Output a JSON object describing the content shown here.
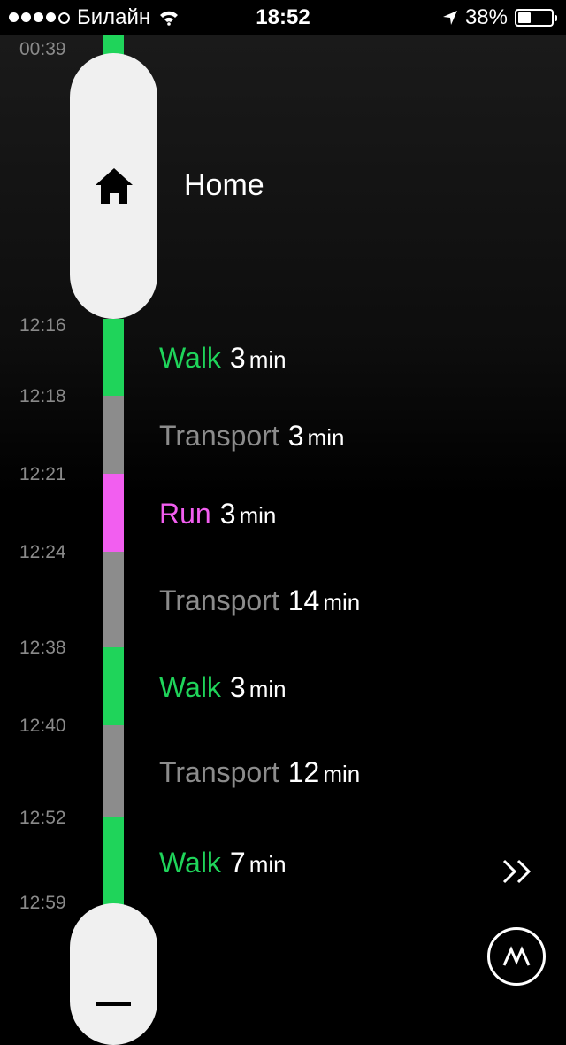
{
  "status_bar": {
    "carrier": "Билайн",
    "time": "18:52",
    "battery": "38%",
    "battery_level": 0.38,
    "signal_bars": 4
  },
  "timeline": {
    "start_time": "00:39",
    "place": {
      "name": "Home",
      "icon": "home-icon"
    },
    "times": [
      "12:16",
      "12:18",
      "12:21",
      "12:24",
      "12:38",
      "12:40",
      "12:52",
      "12:59"
    ],
    "activities": [
      {
        "type": "Walk",
        "duration": "3",
        "unit": "min",
        "color": "#1fd45a"
      },
      {
        "type": "Transport",
        "duration": "3",
        "unit": "min",
        "color": "#8c8c8c"
      },
      {
        "type": "Run",
        "duration": "3",
        "unit": "min",
        "color": "#f25ef0"
      },
      {
        "type": "Transport",
        "duration": "14",
        "unit": "min",
        "color": "#8c8c8c"
      },
      {
        "type": "Walk",
        "duration": "3",
        "unit": "min",
        "color": "#1fd45a"
      },
      {
        "type": "Transport",
        "duration": "12",
        "unit": "min",
        "color": "#8c8c8c"
      },
      {
        "type": "Walk",
        "duration": "7",
        "unit": "min",
        "color": "#1fd45a"
      }
    ]
  },
  "colors": {
    "walk": "#1fd45a",
    "transport": "#8c8c8c",
    "run": "#f25ef0",
    "pill": "#f0f0f0"
  },
  "icons": {
    "more": "double-chevron-right-icon",
    "app": "moves-logo-icon"
  }
}
